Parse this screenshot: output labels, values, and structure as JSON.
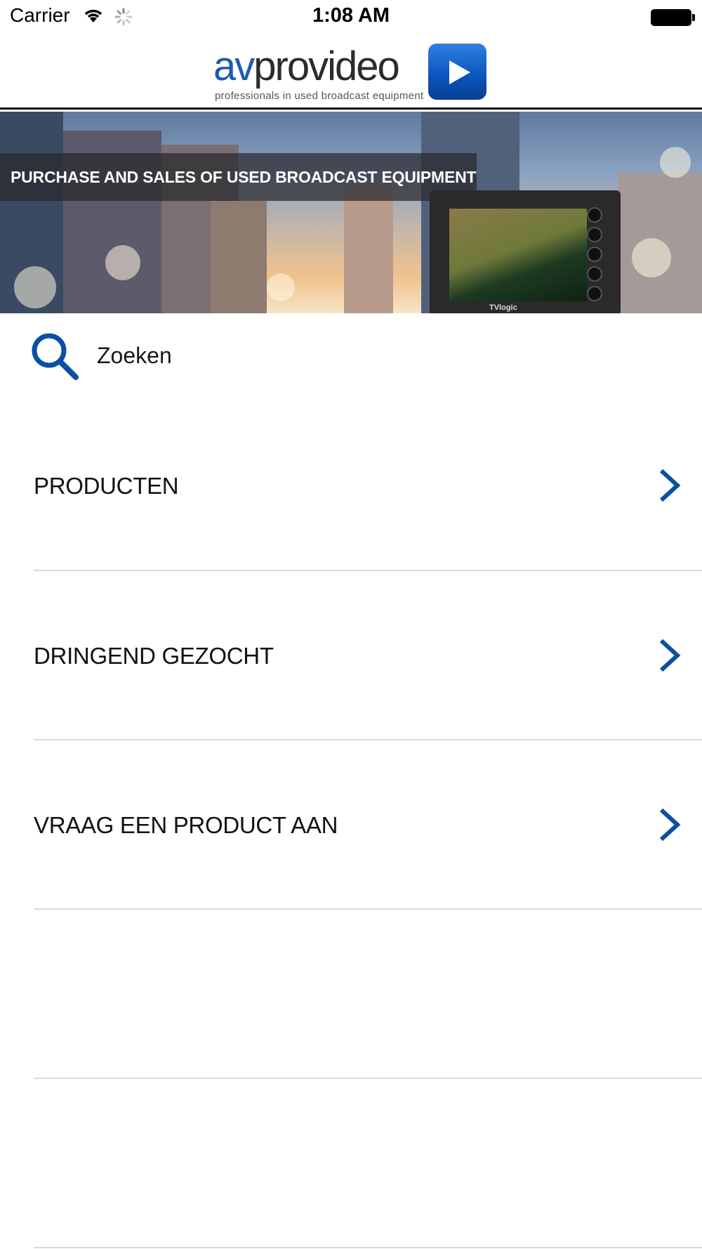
{
  "status_bar": {
    "carrier": "Carrier",
    "time": "1:08 AM",
    "icons": [
      "wifi-icon",
      "activity-spinner-icon",
      "battery-icon"
    ]
  },
  "header": {
    "logo_prefix": "av",
    "logo_main": "provideo",
    "tagline": "professionals in used broadcast equipment",
    "logo_icon": "play-icon",
    "brand_color": "#1d5bb0"
  },
  "banner": {
    "caption": "PURCHASE AND SALES OF USED BROADCAST EQUIPMENT",
    "monitor_brand": "TVlogic"
  },
  "search": {
    "label": "Zoeken",
    "icon": "search-icon"
  },
  "menu": {
    "items": [
      {
        "label": "PRODUCTEN",
        "icon": "chevron-right-icon"
      },
      {
        "label": "DRINGEND GEZOCHT",
        "icon": "chevron-right-icon"
      },
      {
        "label": "VRAAG EEN PRODUCT AAN",
        "icon": "chevron-right-icon"
      }
    ]
  },
  "colors": {
    "accent": "#0b4fa3",
    "divider": "#d9d9d9"
  }
}
